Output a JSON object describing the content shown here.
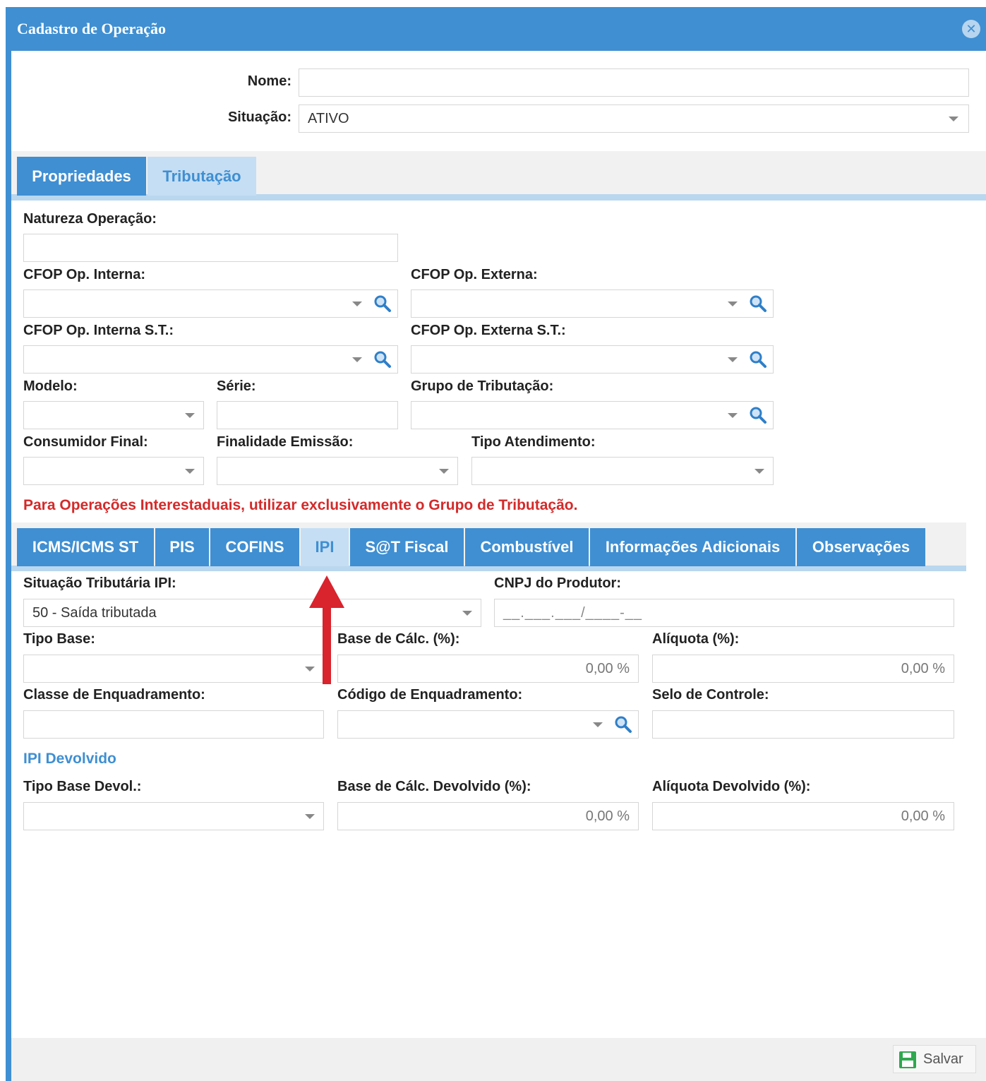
{
  "window": {
    "title": "Cadastro de Operação"
  },
  "header": {
    "nome_label": "Nome:",
    "nome_value": "",
    "situacao_label": "Situação:",
    "situacao_value": "ATIVO"
  },
  "main_tabs": [
    {
      "label": "Propriedades",
      "active": false
    },
    {
      "label": "Tributação",
      "active": true
    }
  ],
  "form": {
    "natureza_label": "Natureza Operação:",
    "cfop_interna_label": "CFOP Op. Interna:",
    "cfop_externa_label": "CFOP Op. Externa:",
    "cfop_interna_st_label": "CFOP Op. Interna S.T.:",
    "cfop_externa_st_label": "CFOP Op. Externa S.T.:",
    "modelo_label": "Modelo:",
    "serie_label": "Série:",
    "grupo_label": "Grupo de Tributação:",
    "consumidor_label": "Consumidor Final:",
    "finalidade_label": "Finalidade Emissão:",
    "atendimento_label": "Tipo Atendimento:",
    "warning": "Para Operações Interestaduais, utilizar exclusivamente o Grupo de Tributação."
  },
  "tax_tabs": [
    {
      "label": "ICMS/ICMS ST",
      "active": false
    },
    {
      "label": "PIS",
      "active": false
    },
    {
      "label": "COFINS",
      "active": false
    },
    {
      "label": "IPI",
      "active": true
    },
    {
      "label": "S@T Fiscal",
      "active": false
    },
    {
      "label": "Combustível",
      "active": false
    },
    {
      "label": "Informações Adicionais",
      "active": false
    },
    {
      "label": "Observações",
      "active": false
    }
  ],
  "ipi": {
    "situacao_label": "Situação Tributária IPI:",
    "situacao_value": "50 - Saída tributada",
    "cnpj_label": "CNPJ do Produtor:",
    "cnpj_placeholder": "__.___.___/____-__",
    "tipo_base_label": "Tipo Base:",
    "base_calc_label": "Base de Cálc. (%):",
    "base_calc_value": "0,00 %",
    "aliquota_label": "Alíquota (%):",
    "aliquota_value": "0,00 %",
    "classe_label": "Classe de Enquadramento:",
    "codigo_label": "Código de Enquadramento:",
    "selo_label": "Selo de Controle:",
    "devolvido_title": "IPI Devolvido",
    "tipo_base_devol_label": "Tipo Base Devol.:",
    "base_calc_devol_label": "Base de Cálc. Devolvido (%):",
    "base_calc_devol_value": "0,00 %",
    "aliquota_devol_label": "Alíquota Devolvido (%):",
    "aliquota_devol_value": "0,00 %"
  },
  "footer": {
    "save_label": "Salvar"
  },
  "colors": {
    "accent": "#3f8fd2",
    "warning": "#d42a2a",
    "tab_light": "#c5def4",
    "arrow": "#d9232d"
  }
}
